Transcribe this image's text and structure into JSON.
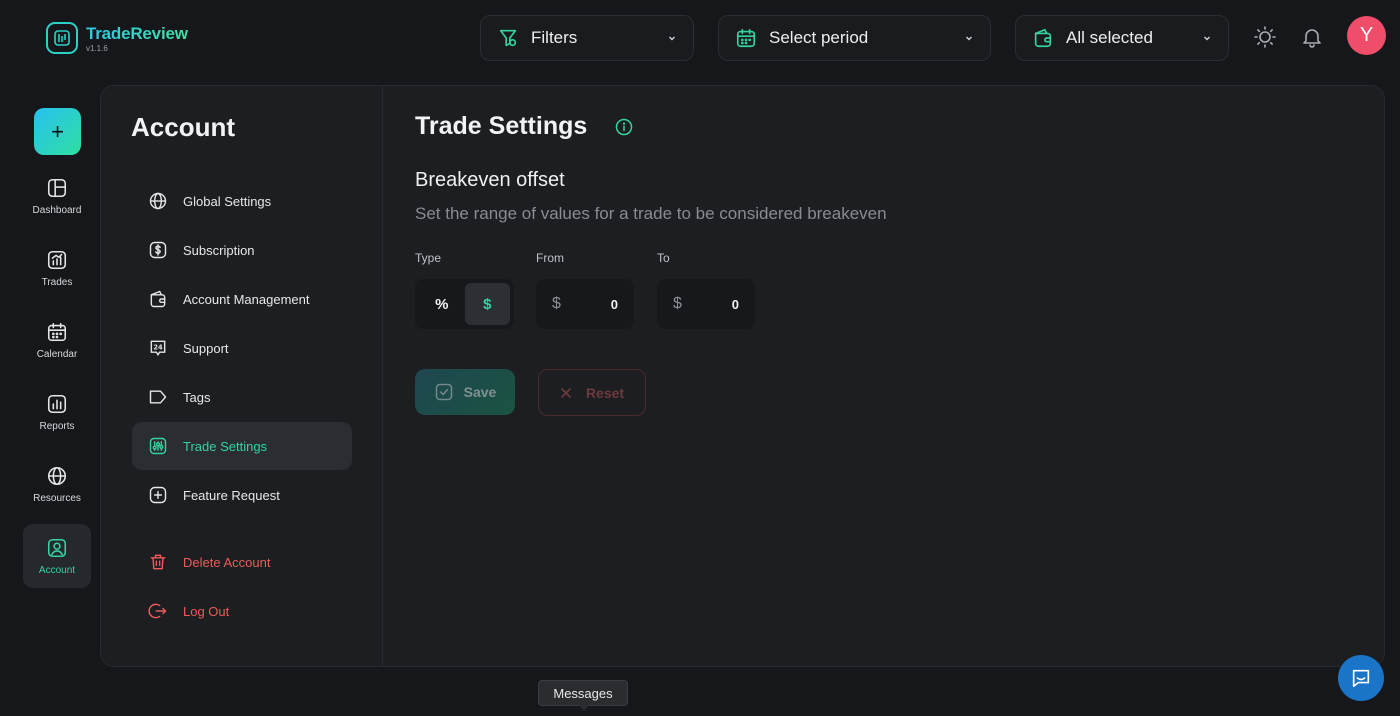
{
  "app": {
    "name": "TradeReview",
    "version": "v1.1.6"
  },
  "topbar": {
    "filters_label": "Filters",
    "period_label": "Select period",
    "accounts_label": "All selected",
    "avatar_initial": "Y"
  },
  "rail": {
    "items": [
      {
        "label": "Dashboard",
        "icon": "dashboard-icon"
      },
      {
        "label": "Trades",
        "icon": "trades-chart-icon"
      },
      {
        "label": "Calendar",
        "icon": "calendar-icon"
      },
      {
        "label": "Reports",
        "icon": "reports-icon"
      },
      {
        "label": "Resources",
        "icon": "globe-icon"
      },
      {
        "label": "Account",
        "icon": "account-icon",
        "active": true
      }
    ]
  },
  "account_menu": {
    "title": "Account",
    "items": [
      {
        "label": "Global Settings",
        "icon": "globe-icon"
      },
      {
        "label": "Subscription",
        "icon": "dollar-icon"
      },
      {
        "label": "Account Management",
        "icon": "wallet-icon"
      },
      {
        "label": "Support",
        "icon": "support-24-icon"
      },
      {
        "label": "Tags",
        "icon": "tag-icon"
      },
      {
        "label": "Trade Settings",
        "icon": "sliders-icon",
        "active": true
      },
      {
        "label": "Feature Request",
        "icon": "plus-square-icon"
      }
    ],
    "danger_items": [
      {
        "label": "Delete Account",
        "icon": "trash-icon"
      },
      {
        "label": "Log Out",
        "icon": "logout-icon"
      }
    ]
  },
  "content": {
    "title": "Trade Settings",
    "section_title": "Breakeven offset",
    "section_desc": "Set the range of values for a trade to be considered breakeven",
    "type_label": "Type",
    "from_label": "From",
    "to_label": "To",
    "type_options": [
      "%",
      "$"
    ],
    "type_selected": "$",
    "from_prefix": "$",
    "from_value": "0",
    "to_prefix": "$",
    "to_value": "0",
    "save_label": "Save",
    "reset_label": "Reset"
  },
  "tooltip": "Messages",
  "colors": {
    "accent": "#35d3a0",
    "danger": "#ef5a5a",
    "avatar": "#ef4d6a",
    "chat": "#1a74c8"
  }
}
